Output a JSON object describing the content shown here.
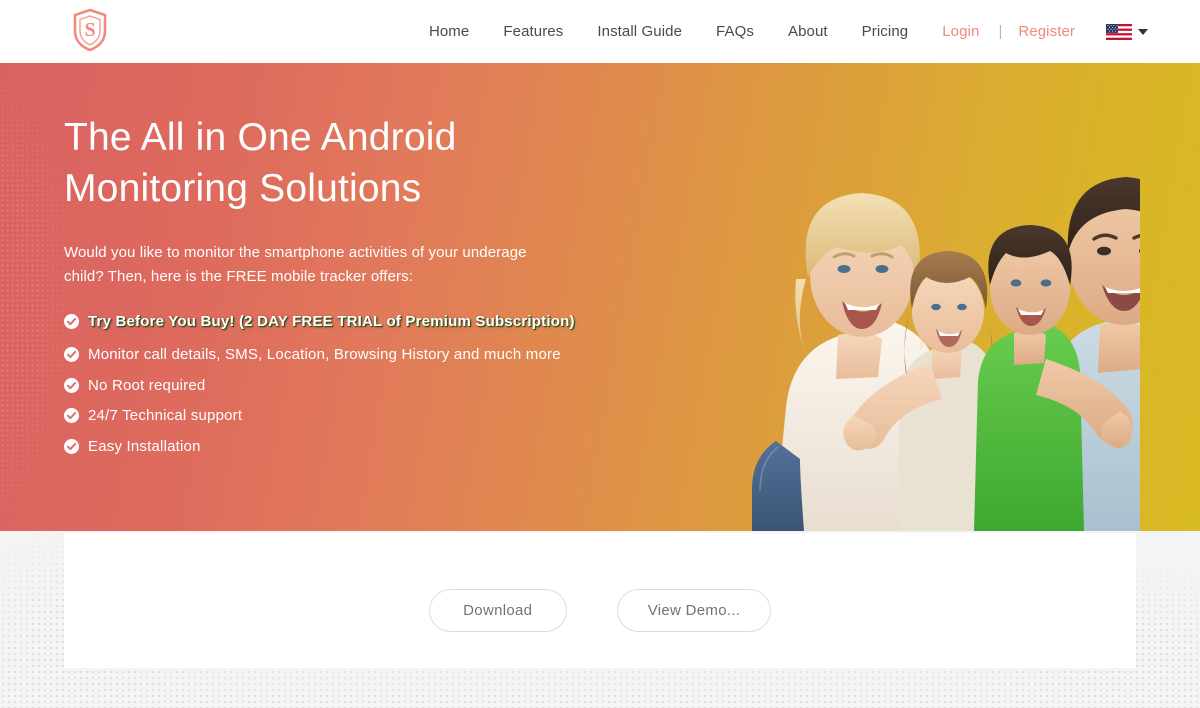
{
  "header": {
    "logo_icon": "shield-s-logo-icon",
    "logo_color": "#f1897c",
    "nav": [
      {
        "label": "Home",
        "name": "nav-home",
        "style": "default"
      },
      {
        "label": "Features",
        "name": "nav-features",
        "style": "default"
      },
      {
        "label": "Install Guide",
        "name": "nav-install-guide",
        "style": "default"
      },
      {
        "label": "FAQs",
        "name": "nav-faqs",
        "style": "default"
      },
      {
        "label": "About",
        "name": "nav-about",
        "style": "default"
      },
      {
        "label": "Pricing",
        "name": "nav-pricing",
        "style": "default"
      }
    ],
    "login_label": "Login",
    "separator": "|",
    "register_label": "Register",
    "language_flag_icon": "us-flag-icon",
    "language_caret_icon": "chevron-down-icon",
    "accent_color": "#f1897c",
    "nav_text_color": "#4a4a4a"
  },
  "hero": {
    "title": "The All in One Android Monitoring Solutions",
    "subtitle": "Would you like to monitor the smartphone activities of your underage child? Then, here is the FREE mobile tracker offers:",
    "features": [
      "Try Before You Buy! (2 DAY FREE TRIAL of Premium Subscription)",
      "Monitor call details, SMS, Location, Browsing History and much more",
      "No Root required",
      "24/7 Technical support",
      "Easy Installation"
    ],
    "check_icon": "check-circle-icon",
    "gradient_start": "#d9615f",
    "gradient_end": "#d8ba24",
    "photo_alt": "happy-family-photo"
  },
  "cta": {
    "download_label": "Download",
    "demo_label": "View Demo...",
    "border_color": "#dcdcdc",
    "text_color": "#6f7478"
  }
}
